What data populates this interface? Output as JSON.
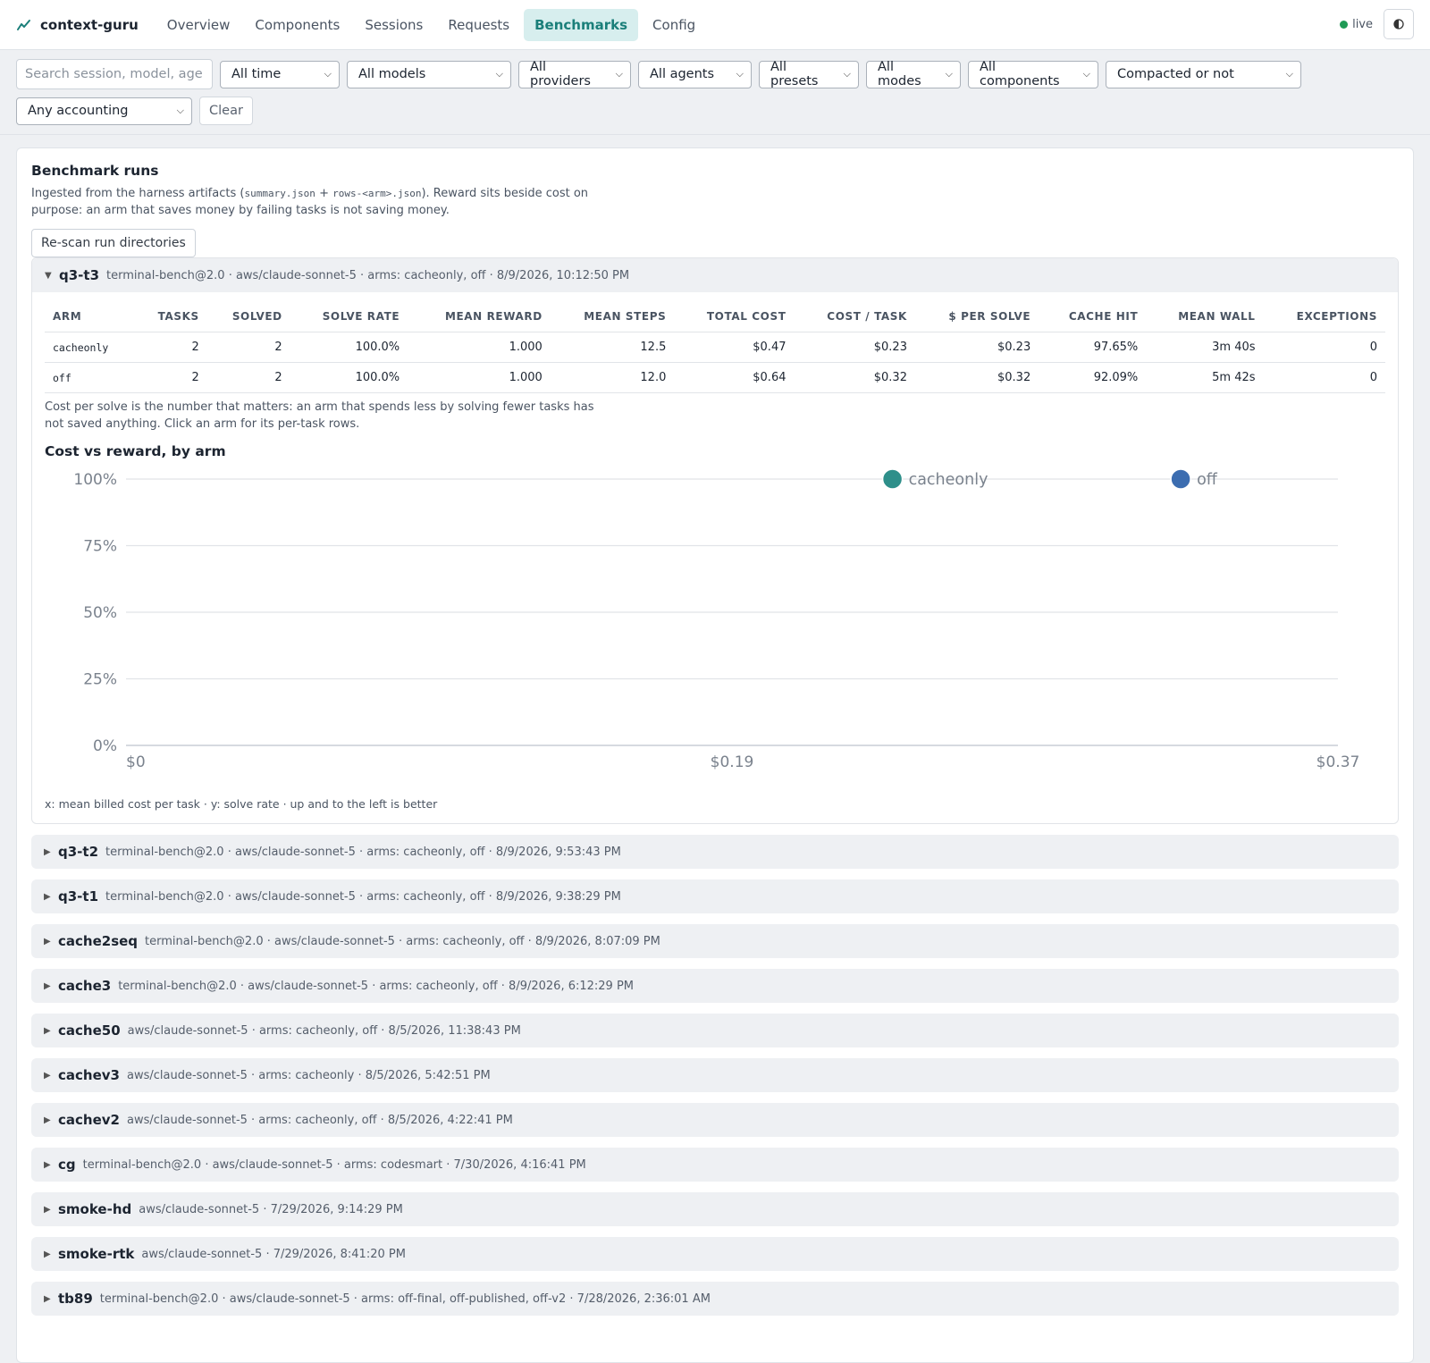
{
  "app": {
    "name": "context-guru"
  },
  "nav": {
    "tabs": [
      {
        "label": "Overview"
      },
      {
        "label": "Components"
      },
      {
        "label": "Sessions"
      },
      {
        "label": "Requests"
      },
      {
        "label": "Benchmarks",
        "active": true
      },
      {
        "label": "Config"
      }
    ],
    "live_label": "live",
    "theme_icon": "contrast-icon"
  },
  "filters": {
    "search_placeholder": "Search session, model, age",
    "selects": [
      "All time",
      "All models",
      "All providers",
      "All agents",
      "All presets",
      "All modes",
      "All components",
      "Compacted or not",
      "Any accounting"
    ],
    "clear_label": "Clear"
  },
  "panel": {
    "title": "Benchmark runs",
    "desc_prefix": "Ingested from the harness artifacts (",
    "desc_code1": "summary.json",
    "desc_plus": " + ",
    "desc_code2": "rows-<arm>.json",
    "desc_suffix": "). Reward sits beside cost on purpose: an arm that saves money by failing tasks is not saving money.",
    "rescan_label": "Re-scan run directories"
  },
  "open_run": {
    "name": "q3-t3",
    "meta": "terminal-bench@2.0 · aws/claude-sonnet-5 · arms: cacheonly, off · 8/9/2026, 10:12:50 PM",
    "columns": [
      "ARM",
      "TASKS",
      "SOLVED",
      "SOLVE RATE",
      "MEAN REWARD",
      "MEAN STEPS",
      "TOTAL COST",
      "COST / TASK",
      "$ PER SOLVE",
      "CACHE HIT",
      "MEAN WALL",
      "EXCEPTIONS"
    ],
    "rows": [
      [
        "cacheonly",
        "2",
        "2",
        "100.0%",
        "1.000",
        "12.5",
        "$0.47",
        "$0.23",
        "$0.23",
        "97.65%",
        "3m 40s",
        "0"
      ],
      [
        "off",
        "2",
        "2",
        "100.0%",
        "1.000",
        "12.0",
        "$0.64",
        "$0.32",
        "$0.32",
        "92.09%",
        "5m 42s",
        "0"
      ]
    ],
    "table_note": "Cost per solve is the number that matters: an arm that spends less by solving fewer tasks has not saved anything. Click an arm for its per-task rows.",
    "chart_title": "Cost vs reward, by arm",
    "chart_foot": "x: mean billed cost per task · y: solve rate · up and to the left is better"
  },
  "chart_data": {
    "type": "scatter",
    "title": "Cost vs reward, by arm",
    "xlabel": "mean billed cost per task",
    "ylabel": "solve rate",
    "xlim": [
      0,
      0.37
    ],
    "ylim": [
      0,
      100
    ],
    "x_ticks": [
      "$0",
      "$0.19",
      "$0.37"
    ],
    "x_tick_values": [
      0,
      0.185,
      0.37
    ],
    "y_ticks": [
      "0%",
      "25%",
      "50%",
      "75%",
      "100%"
    ],
    "y_tick_values": [
      0,
      25,
      50,
      75,
      100
    ],
    "grid": true,
    "series": [
      {
        "name": "cacheonly",
        "x": 0.234,
        "y": 100,
        "color": "#2e8f8a"
      },
      {
        "name": "off",
        "x": 0.322,
        "y": 100,
        "color": "#3c6db0"
      }
    ]
  },
  "runs": [
    {
      "name": "q3-t2",
      "meta": "terminal-bench@2.0 · aws/claude-sonnet-5 · arms: cacheonly, off · 8/9/2026, 9:53:43 PM"
    },
    {
      "name": "q3-t1",
      "meta": "terminal-bench@2.0 · aws/claude-sonnet-5 · arms: cacheonly, off · 8/9/2026, 9:38:29 PM"
    },
    {
      "name": "cache2seq",
      "meta": "terminal-bench@2.0 · aws/claude-sonnet-5 · arms: cacheonly, off · 8/9/2026, 8:07:09 PM"
    },
    {
      "name": "cache3",
      "meta": "terminal-bench@2.0 · aws/claude-sonnet-5 · arms: cacheonly, off · 8/9/2026, 6:12:29 PM"
    },
    {
      "name": "cache50",
      "meta": "aws/claude-sonnet-5 · arms: cacheonly, off · 8/5/2026, 11:38:43 PM"
    },
    {
      "name": "cachev3",
      "meta": "aws/claude-sonnet-5 · arms: cacheonly · 8/5/2026, 5:42:51 PM"
    },
    {
      "name": "cachev2",
      "meta": "aws/claude-sonnet-5 · arms: cacheonly, off · 8/5/2026, 4:22:41 PM"
    },
    {
      "name": "cg",
      "meta": "terminal-bench@2.0 · aws/claude-sonnet-5 · arms: codesmart · 7/30/2026, 4:16:41 PM"
    },
    {
      "name": "smoke-hd",
      "meta": "aws/claude-sonnet-5 · 7/29/2026, 9:14:29 PM"
    },
    {
      "name": "smoke-rtk",
      "meta": "aws/claude-sonnet-5 · 7/29/2026, 8:41:20 PM"
    },
    {
      "name": "tb89",
      "meta": "terminal-bench@2.0 · aws/claude-sonnet-5 · arms: off-final, off-published, off-v2 · 7/28/2026, 2:36:01 AM"
    }
  ]
}
